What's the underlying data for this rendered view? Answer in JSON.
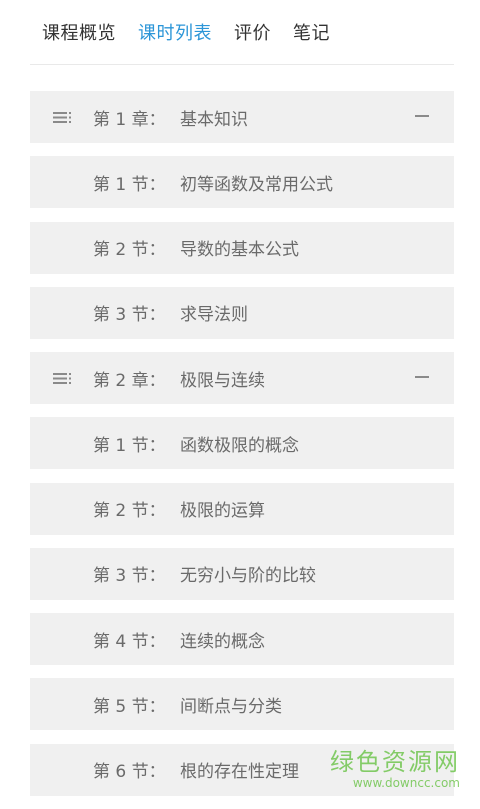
{
  "tabs": [
    {
      "label": "课程概览",
      "active": false
    },
    {
      "label": "课时列表",
      "active": true
    },
    {
      "label": "评价",
      "active": false
    },
    {
      "label": "笔记",
      "active": false
    }
  ],
  "rows": [
    {
      "type": "chapter",
      "prefix": "第 1 章：",
      "title": "基本知识"
    },
    {
      "type": "section",
      "prefix": "第 1 节：",
      "title": "初等函数及常用公式"
    },
    {
      "type": "section",
      "prefix": "第 2 节：",
      "title": "导数的基本公式"
    },
    {
      "type": "section",
      "prefix": "第 3 节：",
      "title": "求导法则"
    },
    {
      "type": "chapter",
      "prefix": "第 2 章：",
      "title": "极限与连续"
    },
    {
      "type": "section",
      "prefix": "第 1 节：",
      "title": "函数极限的概念"
    },
    {
      "type": "section",
      "prefix": "第 2 节：",
      "title": "极限的运算"
    },
    {
      "type": "section",
      "prefix": "第 3 节：",
      "title": "无穷小与阶的比较"
    },
    {
      "type": "section",
      "prefix": "第 4 节：",
      "title": "连续的概念"
    },
    {
      "type": "section",
      "prefix": "第 5 节：",
      "title": "间断点与分类"
    },
    {
      "type": "section",
      "prefix": "第 6 节：",
      "title": "根的存在性定理"
    }
  ],
  "watermark": {
    "name": "绿色资源网",
    "url": "www.downcc.com"
  },
  "colors": {
    "active_tab": "#2c96d8",
    "row_bg": "#f0f0f0",
    "watermark": "#5fbf3a"
  },
  "icons": {
    "chapter_handle": "list-handle-icon",
    "chapter_collapse": "minus-icon"
  }
}
